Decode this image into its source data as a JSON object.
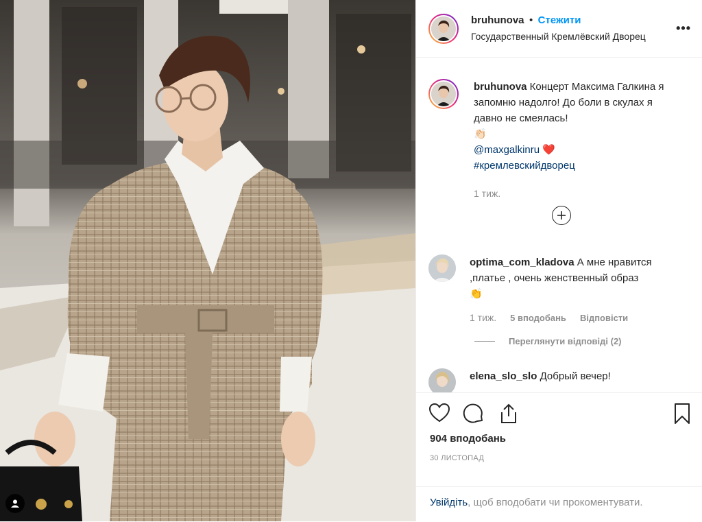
{
  "post": {
    "username": "bruhunova",
    "separator": "•",
    "follow_label": "Стежити",
    "location": "Государственный Кремлёвский Дворец",
    "more_label": "•••"
  },
  "caption": {
    "username": "bruhunova",
    "text": "Концерт Максима Галкина я запомню надолго! До боли в скулах я давно не смеялась!",
    "emoji": "👏🏻",
    "mention": "@maxgalkinru",
    "heart": "❤️",
    "hashtag": "#кремлевскийдворец",
    "time": "1 тиж."
  },
  "comments": [
    {
      "username": "optima_com_kladova",
      "text": "А мне нравится ,платье , очень женственный образ",
      "emoji": "👏",
      "time": "1 тиж.",
      "likes": "5 вподобань",
      "reply": "Відповісти",
      "view_replies": "Переглянути відповіді (2)"
    },
    {
      "username": "elena_slo_slo",
      "text": "Добрый вечер!"
    }
  ],
  "likes_count": "904 вподобань",
  "date": "30 листопад",
  "login_prompt": {
    "link": "Увійдіть",
    "text": ", щоб вподобати чи прокоментувати."
  },
  "colors": {
    "accent": "#0095f6",
    "link": "#00376b",
    "muted": "#8e8e8e",
    "heart": "#ed4956"
  },
  "icons": [
    "heart-icon",
    "comment-icon",
    "share-icon",
    "bookmark-icon",
    "add-comment-icon",
    "tag-user-icon",
    "more-options-icon"
  ]
}
